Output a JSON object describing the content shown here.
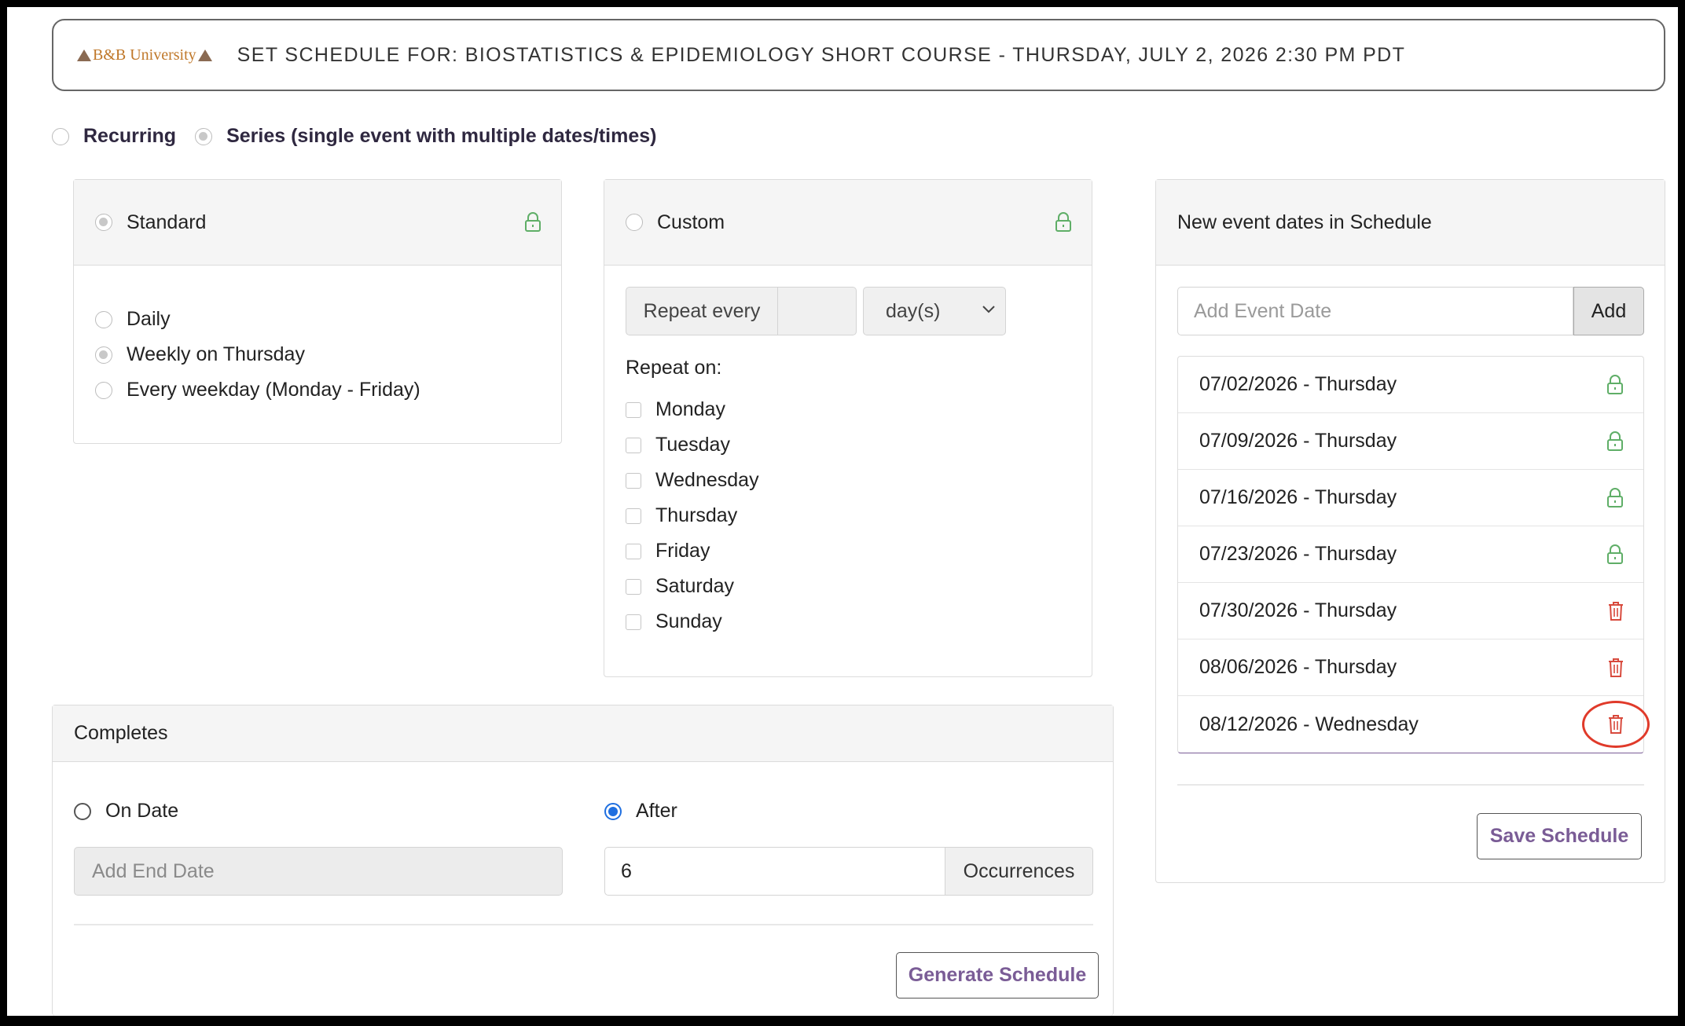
{
  "header": {
    "logo_text": "B&B University",
    "title": "SET SCHEDULE FOR: BIOSTATISTICS & EPIDEMIOLOGY SHORT COURSE - THURSDAY, JULY 2, 2026 2:30 PM PDT"
  },
  "mode": {
    "recurring_label": "Recurring",
    "series_label": "Series (single event with multiple dates/times)",
    "selected": "series"
  },
  "standard": {
    "title": "Standard",
    "options": [
      "Daily",
      "Weekly on Thursday",
      "Every weekday (Monday - Friday)"
    ],
    "selected_option": "Weekly on Thursday"
  },
  "custom": {
    "title": "Custom",
    "repeat_every_label": "Repeat every",
    "repeat_every_value": "",
    "unit_selected": "day(s)",
    "repeat_on_label": "Repeat on:",
    "days": [
      "Monday",
      "Tuesday",
      "Wednesday",
      "Thursday",
      "Friday",
      "Saturday",
      "Sunday"
    ]
  },
  "completes": {
    "title": "Completes",
    "on_date_label": "On Date",
    "end_date_placeholder": "Add End Date",
    "after_label": "After",
    "occurrences_value": "6",
    "occurrences_label": "Occurrences",
    "selected": "after",
    "generate_button": "Generate Schedule"
  },
  "schedule": {
    "title": "New event dates in Schedule",
    "add_placeholder": "Add Event Date",
    "add_button": "Add",
    "dates": [
      {
        "label": "07/02/2026 - Thursday",
        "icon": "lock-icon"
      },
      {
        "label": "07/09/2026 - Thursday",
        "icon": "lock-icon"
      },
      {
        "label": "07/16/2026 - Thursday",
        "icon": "lock-icon"
      },
      {
        "label": "07/23/2026 - Thursday",
        "icon": "lock-icon"
      },
      {
        "label": "07/30/2026 - Thursday",
        "icon": "trash-icon"
      },
      {
        "label": "08/06/2026 - Thursday",
        "icon": "trash-icon"
      },
      {
        "label": "08/12/2026 - Wednesday",
        "icon": "trash-icon"
      }
    ],
    "highlighted_index": 6,
    "save_button": "Save Schedule"
  },
  "colors": {
    "lock": "#5fae67",
    "trash": "#d84a3d",
    "highlight": "#e03a2a",
    "accent": "#7a5c96",
    "radio_selected": "#1f6fe0"
  }
}
